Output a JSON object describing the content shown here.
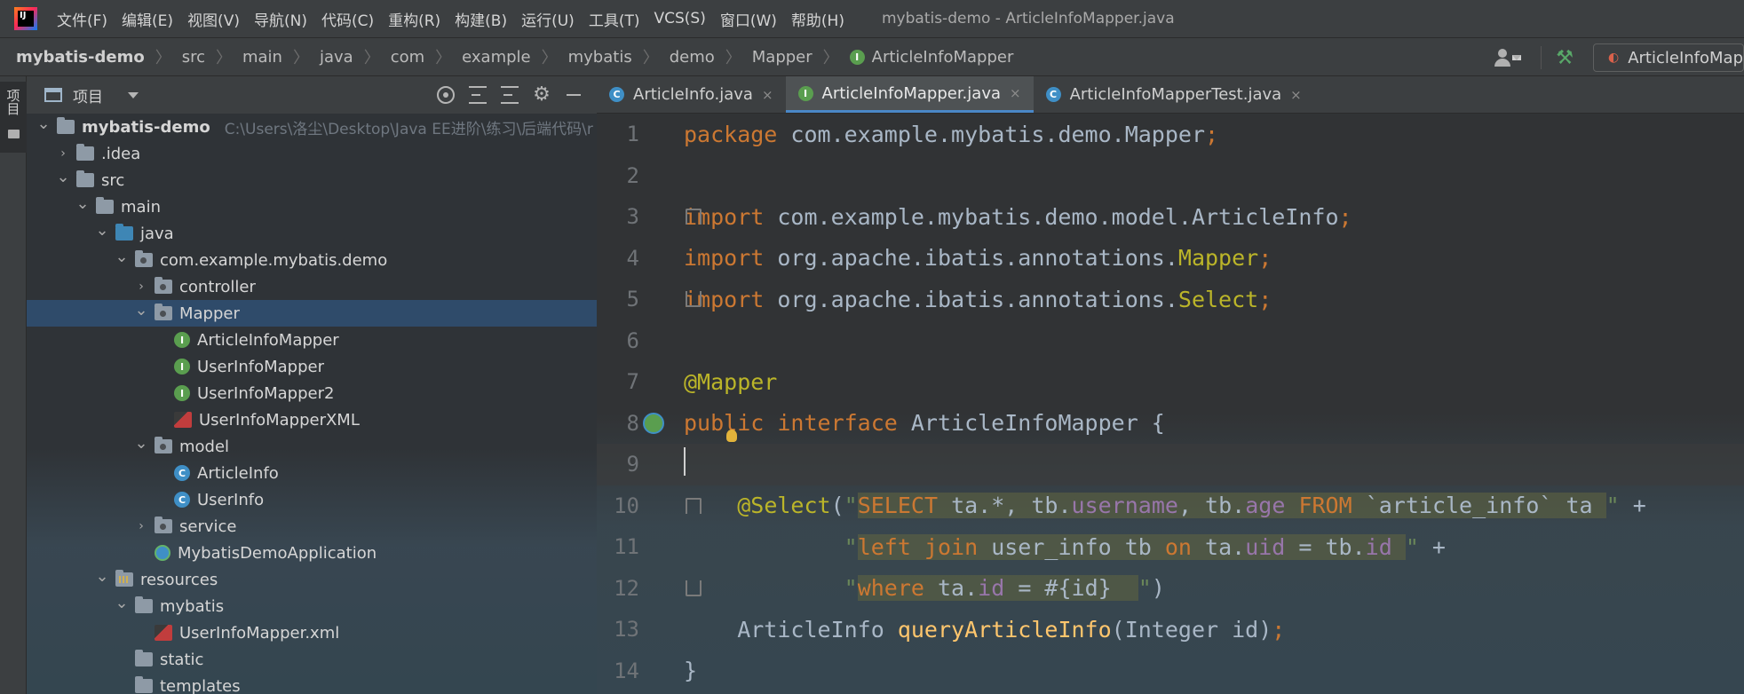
{
  "menubar": {
    "items": [
      "文件(F)",
      "编辑(E)",
      "视图(V)",
      "导航(N)",
      "代码(C)",
      "重构(R)",
      "构建(B)",
      "运行(U)",
      "工具(T)",
      "VCS(S)",
      "窗口(W)",
      "帮助(H)"
    ],
    "window_title": "mybatis-demo - ArticleInfoMapper.java"
  },
  "breadcrumbs": [
    "mybatis-demo",
    "src",
    "main",
    "java",
    "com",
    "example",
    "mybatis",
    "demo",
    "Mapper",
    "ArticleInfoMapper"
  ],
  "run_config": {
    "label": "ArticleInfoMapperTest"
  },
  "tool_strip": {
    "project_tab": "项目"
  },
  "project_panel": {
    "title": "项目",
    "tree": [
      {
        "label": "mybatis-demo",
        "hint": "C:\\Users\\洛尘\\Desktop\\Java EE进阶\\练习\\后端代码\\r",
        "depth": 0,
        "chev": "down",
        "icon": "folder"
      },
      {
        "label": ".idea",
        "depth": 1,
        "chev": "right",
        "icon": "folder"
      },
      {
        "label": "src",
        "depth": 1,
        "chev": "down",
        "icon": "folder"
      },
      {
        "label": "main",
        "depth": 2,
        "chev": "down",
        "icon": "folder"
      },
      {
        "label": "java",
        "depth": 3,
        "chev": "down",
        "icon": "folder-blue"
      },
      {
        "label": "com.example.mybatis.demo",
        "depth": 4,
        "chev": "down",
        "icon": "package"
      },
      {
        "label": "controller",
        "depth": 5,
        "chev": "right",
        "icon": "package"
      },
      {
        "label": "Mapper",
        "depth": 5,
        "chev": "down",
        "icon": "package",
        "selected": true
      },
      {
        "label": "ArticleInfoMapper",
        "depth": 6,
        "chev": "none",
        "icon": "interface"
      },
      {
        "label": "UserInfoMapper",
        "depth": 6,
        "chev": "none",
        "icon": "interface"
      },
      {
        "label": "UserInfoMapper2",
        "depth": 6,
        "chev": "none",
        "icon": "interface"
      },
      {
        "label": "UserInfoMapperXML",
        "depth": 6,
        "chev": "none",
        "icon": "xml"
      },
      {
        "label": "model",
        "depth": 5,
        "chev": "down",
        "icon": "package"
      },
      {
        "label": "ArticleInfo",
        "depth": 6,
        "chev": "none",
        "icon": "class"
      },
      {
        "label": "UserInfo",
        "depth": 6,
        "chev": "none",
        "icon": "class"
      },
      {
        "label": "service",
        "depth": 5,
        "chev": "right",
        "icon": "package"
      },
      {
        "label": "MybatisDemoApplication",
        "depth": 5,
        "chev": "none",
        "icon": "app"
      },
      {
        "label": "resources",
        "depth": 3,
        "chev": "down",
        "icon": "resources"
      },
      {
        "label": "mybatis",
        "depth": 4,
        "chev": "down",
        "icon": "folder"
      },
      {
        "label": "UserInfoMapper.xml",
        "depth": 5,
        "chev": "none",
        "icon": "xml"
      },
      {
        "label": "static",
        "depth": 4,
        "chev": "none",
        "icon": "folder"
      },
      {
        "label": "templates",
        "depth": 4,
        "chev": "none",
        "icon": "folder"
      }
    ]
  },
  "editor": {
    "tabs": [
      {
        "label": "ArticleInfo.java",
        "icon": "class",
        "active": false
      },
      {
        "label": "ArticleInfoMapper.java",
        "icon": "interface",
        "active": true
      },
      {
        "label": "ArticleInfoMapperTest.java",
        "icon": "class",
        "active": false
      }
    ],
    "lines": [
      {
        "n": "1",
        "tokens": [
          [
            "kw",
            "package "
          ],
          [
            "plain",
            "com.example.mybatis.demo.Mapper"
          ],
          [
            "kw",
            ";"
          ]
        ]
      },
      {
        "n": "2",
        "tokens": []
      },
      {
        "n": "3",
        "tokens": [
          [
            "kw",
            "import "
          ],
          [
            "plain",
            "com.example.mybatis.demo.model.ArticleInfo"
          ],
          [
            "kw",
            ";"
          ]
        ]
      },
      {
        "n": "4",
        "tokens": [
          [
            "kw",
            "import "
          ],
          [
            "plain",
            "org.apache.ibatis.annotations."
          ],
          [
            "ann",
            "Mapper"
          ],
          [
            "kw",
            ";"
          ]
        ]
      },
      {
        "n": "5",
        "tokens": [
          [
            "kw",
            "import "
          ],
          [
            "plain",
            "org.apache.ibatis.annotations."
          ],
          [
            "ann",
            "Select"
          ],
          [
            "kw",
            ";"
          ]
        ]
      },
      {
        "n": "6",
        "tokens": []
      },
      {
        "n": "7",
        "tokens": [
          [
            "ann",
            "@Mapper"
          ]
        ]
      },
      {
        "n": "8",
        "tokens": [
          [
            "kw",
            "public interface "
          ],
          [
            "plain",
            "ArticleInfoMapper {"
          ]
        ]
      },
      {
        "n": "9",
        "tokens": []
      },
      {
        "n": "10",
        "tokens": [
          [
            "plain",
            "    "
          ],
          [
            "ann",
            "@Select"
          ],
          [
            "plain",
            "("
          ],
          [
            "str",
            "\""
          ],
          [
            "sqlkw hl",
            "SELECT "
          ],
          [
            "plain hl",
            "ta.*, tb."
          ],
          [
            "fld hl",
            "username"
          ],
          [
            "plain hl",
            ", tb."
          ],
          [
            "fld hl",
            "age "
          ],
          [
            "sqlkw hl",
            "FROM "
          ],
          [
            "plain hl",
            "`article_info` ta "
          ],
          [
            "str",
            "\""
          ],
          [
            "plain",
            " +"
          ]
        ]
      },
      {
        "n": "11",
        "tokens": [
          [
            "plain",
            "            "
          ],
          [
            "str",
            "\""
          ],
          [
            "sqlkw hl",
            "left join "
          ],
          [
            "plain hl",
            "user_info tb "
          ],
          [
            "sqlkw hl",
            "on "
          ],
          [
            "plain hl",
            "ta."
          ],
          [
            "fld hl",
            "uid"
          ],
          [
            "plain hl",
            " = tb."
          ],
          [
            "fld hl",
            "id "
          ],
          [
            "str",
            "\""
          ],
          [
            "plain",
            " +"
          ]
        ]
      },
      {
        "n": "12",
        "tokens": [
          [
            "plain",
            "            "
          ],
          [
            "str",
            "\""
          ],
          [
            "sqlkw hl",
            "where "
          ],
          [
            "plain hl",
            "ta."
          ],
          [
            "fld hl",
            "id"
          ],
          [
            "plain hl",
            " = #{id}  "
          ],
          [
            "str",
            "\""
          ],
          [
            "plain",
            ")"
          ]
        ]
      },
      {
        "n": "13",
        "tokens": [
          [
            "plain",
            "    ArticleInfo "
          ],
          [
            "fn",
            "queryArticleInfo"
          ],
          [
            "plain",
            "(Integer id)"
          ],
          [
            "kw",
            ";"
          ]
        ]
      },
      {
        "n": "14",
        "tokens": [
          [
            "plain",
            "}"
          ]
        ]
      }
    ]
  }
}
